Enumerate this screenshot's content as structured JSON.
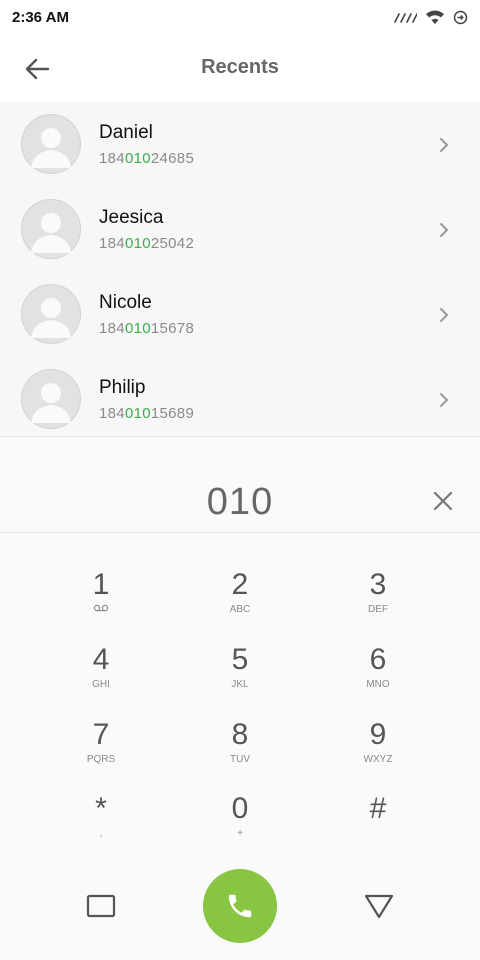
{
  "status_bar": {
    "time": "2:36 AM",
    "icons": [
      "signal-icon",
      "wifi-icon",
      "battery-saver-icon"
    ]
  },
  "header": {
    "title": "Recents",
    "back_icon": "arrow-left-icon"
  },
  "recents": [
    {
      "name": "Daniel",
      "number_prefix": "184",
      "number_match": "010",
      "number_suffix": "24685"
    },
    {
      "name": "Jeesica",
      "number_prefix": "184",
      "number_match": "010",
      "number_suffix": "25042"
    },
    {
      "name": "Nicole",
      "number_prefix": "184",
      "number_match": "010",
      "number_suffix": "15678"
    },
    {
      "name": "Philip",
      "number_prefix": "184",
      "number_match": "010",
      "number_suffix": "15689"
    }
  ],
  "dialer": {
    "input_value": "010",
    "clear_icon": "close-icon",
    "keys": [
      {
        "digit": "1",
        "letters": "voicemail-icon"
      },
      {
        "digit": "2",
        "letters": "ABC"
      },
      {
        "digit": "3",
        "letters": "DEF"
      },
      {
        "digit": "4",
        "letters": "GHI"
      },
      {
        "digit": "5",
        "letters": "JKL"
      },
      {
        "digit": "6",
        "letters": "MNO"
      },
      {
        "digit": "7",
        "letters": "PQRS"
      },
      {
        "digit": "8",
        "letters": "TUV"
      },
      {
        "digit": "9",
        "letters": "WXYZ"
      },
      {
        "digit": "*",
        "letters": ","
      },
      {
        "digit": "0",
        "letters": "+"
      },
      {
        "digit": "#",
        "letters": ""
      }
    ],
    "call_icon": "phone-icon"
  },
  "colors": {
    "accent_green": "#87c542",
    "match_green": "#3aae4c",
    "title_gray": "#666666"
  },
  "nav": {
    "left_icon": "square-icon",
    "right_icon": "triangle-down-icon"
  }
}
